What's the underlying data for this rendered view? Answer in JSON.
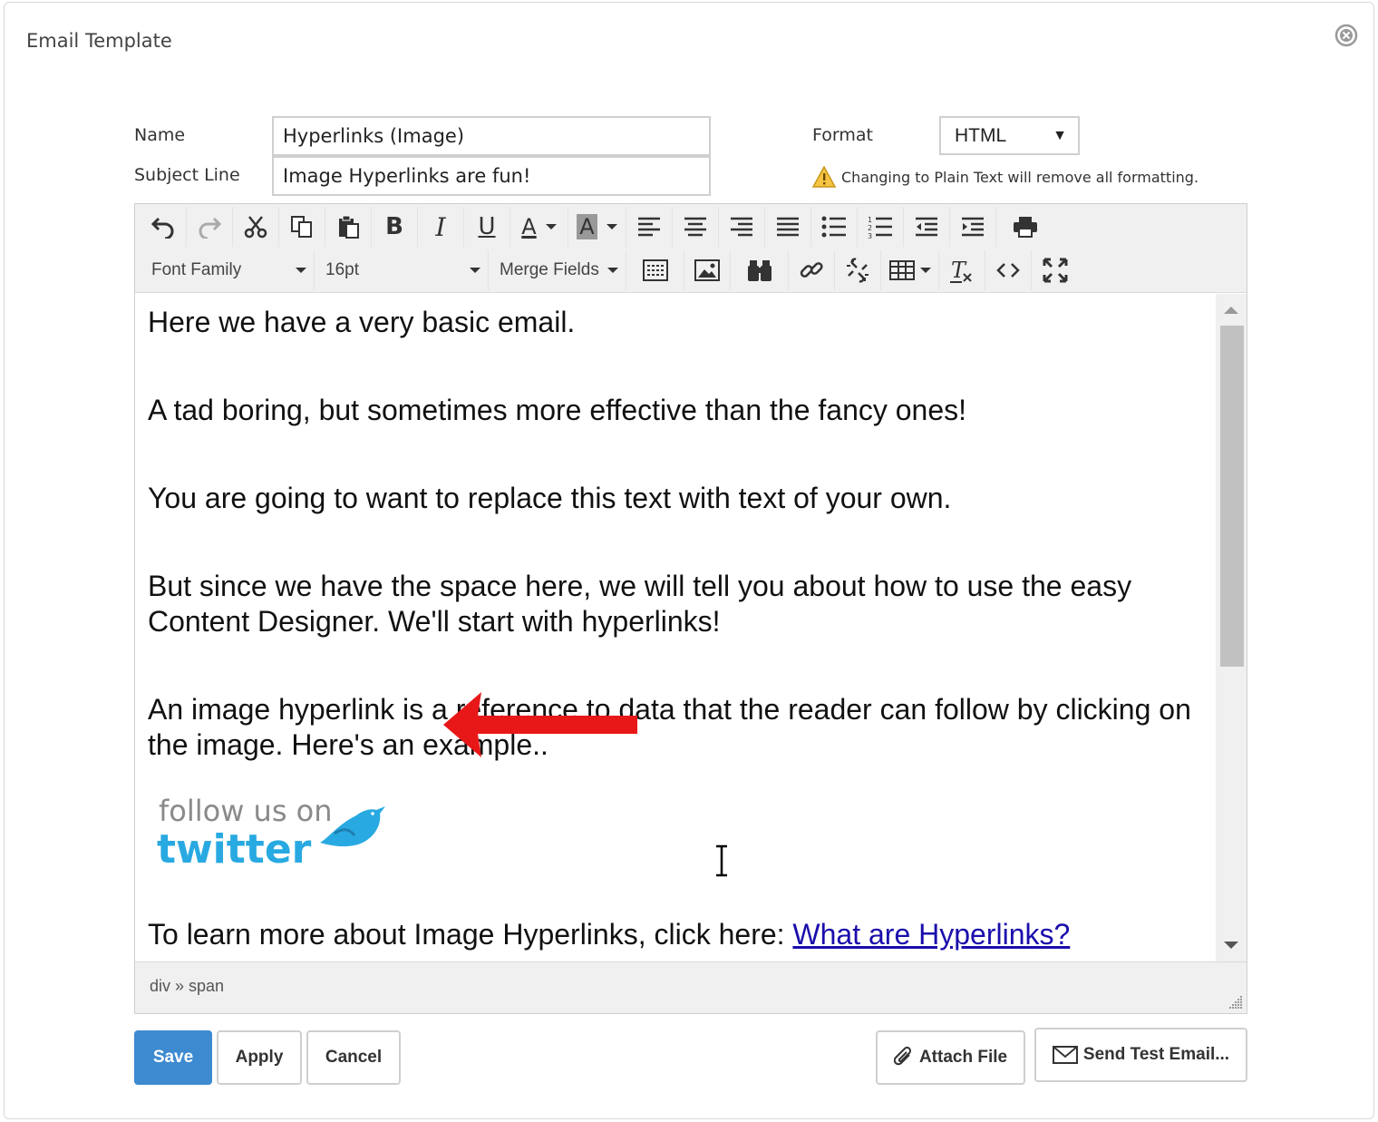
{
  "dialog": {
    "title": "Email Template",
    "close_icon": "close-circle-icon"
  },
  "form": {
    "name_label": "Name",
    "name_value": "Hyperlinks (Image)",
    "subject_label": "Subject Line",
    "subject_value": "Image Hyperlinks are fun!",
    "format_label": "Format",
    "format_value": "HTML",
    "warning_text": "Changing to Plain Text will remove all formatting."
  },
  "toolbar": {
    "font_family": "Font Family",
    "font_size": "16pt",
    "merge_fields": "Merge Fields",
    "row1_icons": [
      "undo-icon",
      "redo-icon",
      "cut-icon",
      "copy-icon",
      "paste-icon",
      "bold-icon",
      "italic-icon",
      "underline-icon",
      "text-color-icon",
      "background-color-icon",
      "align-left-icon",
      "align-center-icon",
      "align-right-icon",
      "justify-icon",
      "bullet-list-icon",
      "numbered-list-icon",
      "outdent-icon",
      "indent-icon",
      "print-icon"
    ],
    "row2_icons": [
      "template-icon",
      "image-icon",
      "find-icon",
      "link-icon",
      "unlink-icon",
      "table-icon",
      "clear-format-icon",
      "source-code-icon",
      "fullscreen-icon"
    ]
  },
  "content": {
    "p1": "Here we have a very basic email.",
    "p2": "A tad boring, but sometimes more effective than the fancy ones!",
    "p3": "You are going to want to replace this text with text of your own.",
    "p4": "But since we have the space here, we will tell you about how to use the easy Content Designer. We'll start with hyperlinks!",
    "p5": "An image hyperlink is a reference to data that the reader can follow by clicking on the image. Here's an example..",
    "image_text_1": "follow us on",
    "image_text_2": "twitter",
    "p6_prefix": "To learn more about Image Hyperlinks, click here: ",
    "p6_link": "What are Hyperlinks?"
  },
  "statusbar": {
    "path": "div » span"
  },
  "buttons": {
    "save": "Save",
    "apply": "Apply",
    "cancel": "Cancel",
    "attach": "Attach File",
    "send_test": "Send Test Email..."
  },
  "colors": {
    "primary": "#3d8ad1",
    "link": "#1a0dab",
    "arrow": "#e81818",
    "twitter_blue": "#29a9e1"
  }
}
